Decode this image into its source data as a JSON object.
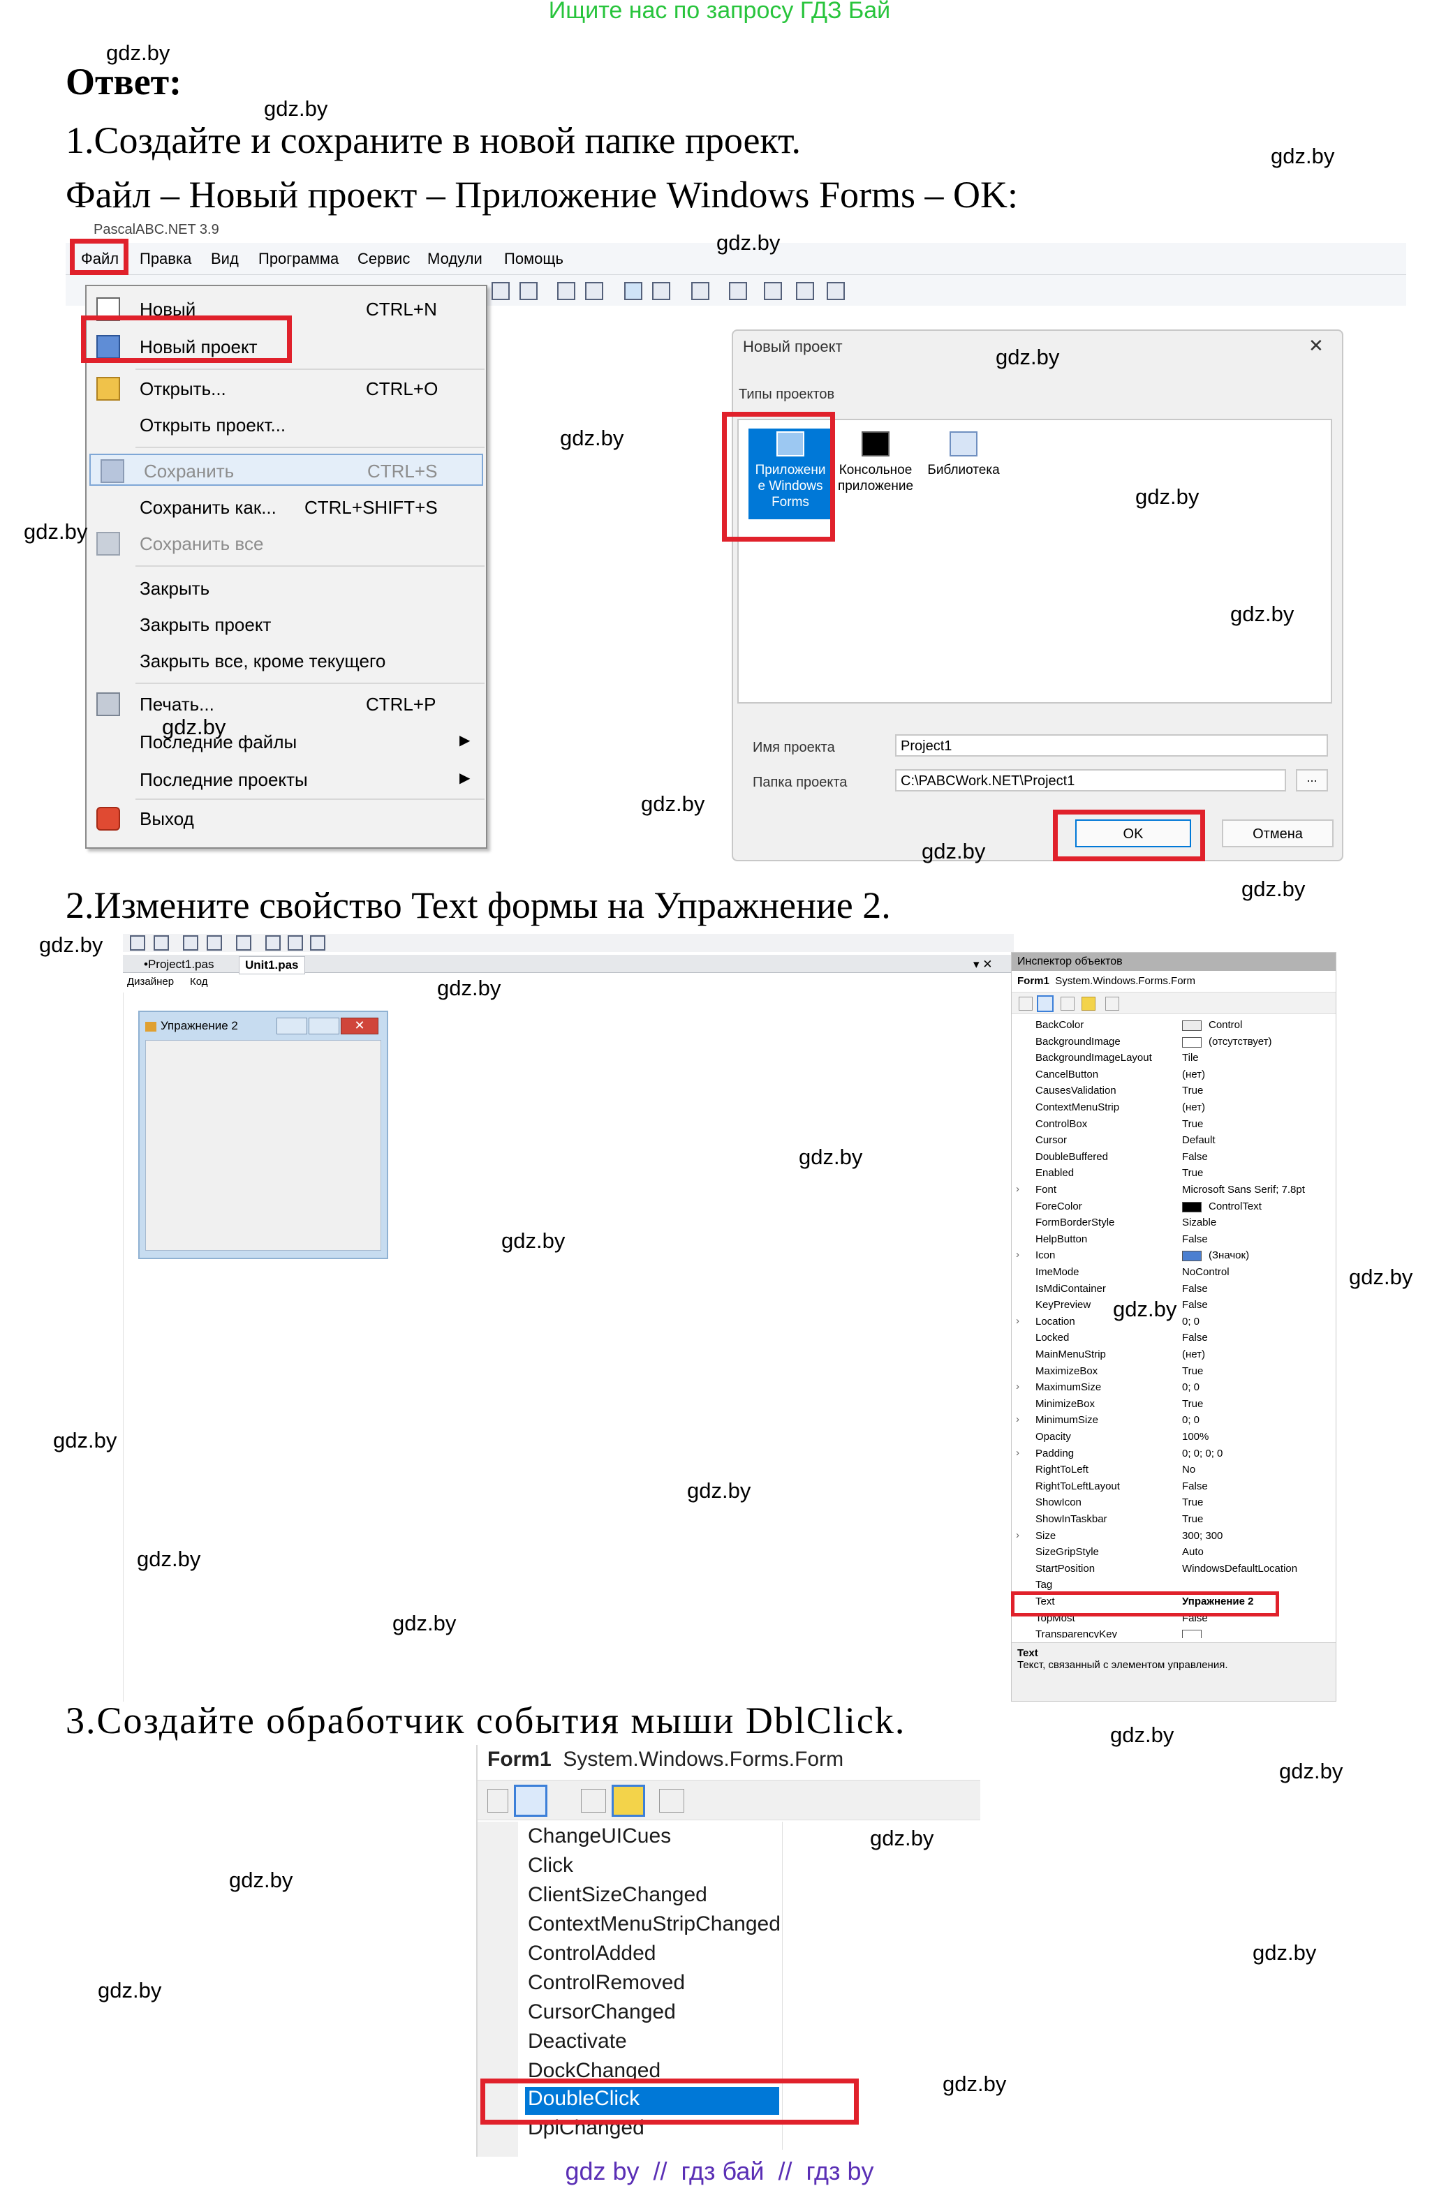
{
  "header": {
    "top_banner": "Ищите нас по запросу ГДЗ Бай",
    "answer_heading": "Ответ:"
  },
  "steps": {
    "step1": "1.Создайте и сохраните в новой папке проект.",
    "step1_path": "Файл – Новый проект – Приложение Windows Forms – OK:",
    "step2": "2.Измените свойство Text формы на Упражнение 2.",
    "step3": "3.Создайте обработчик события мыши DblClick."
  },
  "ide": {
    "title_fragment": "PascalABC.NET 3.9",
    "menu": [
      "Файл",
      "Правка",
      "Вид",
      "Программа",
      "Сервис",
      "Модули",
      "Помощь"
    ],
    "file_menu": [
      {
        "label": "Новый",
        "shortcut": "CTRL+N",
        "icon": "new-file-icon",
        "enabled": true
      },
      {
        "label": "Новый проект",
        "shortcut": "",
        "icon": "new-project-icon",
        "enabled": true
      },
      {
        "label": "Открыть...",
        "shortcut": "CTRL+O",
        "icon": "open-folder-icon",
        "enabled": true
      },
      {
        "label": "Открыть проект...",
        "shortcut": "",
        "icon": "",
        "enabled": true
      },
      {
        "label": "Сохранить",
        "shortcut": "CTRL+S",
        "icon": "save-icon",
        "enabled": false
      },
      {
        "label": "Сохранить как...",
        "shortcut": "CTRL+SHIFT+S",
        "icon": "",
        "enabled": true
      },
      {
        "label": "Сохранить все",
        "shortcut": "",
        "icon": "save-all-icon",
        "enabled": false
      },
      {
        "label": "Закрыть",
        "shortcut": "",
        "icon": "",
        "enabled": true
      },
      {
        "label": "Закрыть проект",
        "shortcut": "",
        "icon": "",
        "enabled": true
      },
      {
        "label": "Закрыть все, кроме текущего",
        "shortcut": "",
        "icon": "",
        "enabled": true
      },
      {
        "label": "Печать...",
        "shortcut": "CTRL+P",
        "icon": "printer-icon",
        "enabled": true
      },
      {
        "label": "Последние файлы",
        "shortcut": "▶",
        "icon": "",
        "enabled": true
      },
      {
        "label": "Последние проекты",
        "shortcut": "▶",
        "icon": "",
        "enabled": true
      },
      {
        "label": "Выход",
        "shortcut": "",
        "icon": "exit-icon",
        "enabled": true
      }
    ]
  },
  "new_project_dialog": {
    "title": "Новый проект",
    "close": "✕",
    "types_label": "Типы проектов",
    "types": [
      {
        "label": "Приложение Windows Forms",
        "line1": "Приложени",
        "line2": "е Windows",
        "line3": "Forms",
        "icon": "windows-forms-icon",
        "selected": true
      },
      {
        "label": "Консольное приложение",
        "line1": "Консольное",
        "line2": "приложение",
        "icon": "console-icon",
        "selected": false
      },
      {
        "label": "Библиотека",
        "line1": "Библиотека",
        "icon": "library-icon",
        "selected": false
      }
    ],
    "name_label": "Имя проекта",
    "name_value": "Project1",
    "folder_label": "Папка проекта",
    "folder_value": "C:\\PABCWork.NET\\Project1",
    "browse": "...",
    "ok": "OK",
    "cancel": "Отмена"
  },
  "designer": {
    "tabs": [
      "•Project1.pas",
      "Unit1.pas"
    ],
    "subtabs": [
      "Дизайнер",
      "Код"
    ],
    "tab_controls": "▾ ✕",
    "form_caption": "Упражнение 2"
  },
  "inspector": {
    "title": "Инспектор объектов",
    "object": "Form1",
    "object_type": "System.Windows.Forms.Form",
    "properties": [
      {
        "name": "BackColor",
        "value": "Control",
        "swatch": "#ececec",
        "expand": false
      },
      {
        "name": "BackgroundImage",
        "value": "(отсутствует)",
        "swatch": "#ffffff",
        "expand": false
      },
      {
        "name": "BackgroundImageLayout",
        "value": "Tile",
        "expand": false
      },
      {
        "name": "CancelButton",
        "value": "(нет)",
        "expand": false
      },
      {
        "name": "CausesValidation",
        "value": "True",
        "expand": false
      },
      {
        "name": "ContextMenuStrip",
        "value": "(нет)",
        "expand": false
      },
      {
        "name": "ControlBox",
        "value": "True",
        "expand": false
      },
      {
        "name": "Cursor",
        "value": "Default",
        "expand": false
      },
      {
        "name": "DoubleBuffered",
        "value": "False",
        "expand": false
      },
      {
        "name": "Enabled",
        "value": "True",
        "expand": false
      },
      {
        "name": "Font",
        "value": "Microsoft Sans Serif; 7.8pt",
        "expand": true
      },
      {
        "name": "ForeColor",
        "value": "ControlText",
        "swatch": "#000000",
        "expand": false
      },
      {
        "name": "FormBorderStyle",
        "value": "Sizable",
        "expand": false
      },
      {
        "name": "HelpButton",
        "value": "False",
        "expand": false
      },
      {
        "name": "Icon",
        "value": "(Значок)",
        "swatch": "#4b7fd0",
        "expand": true
      },
      {
        "name": "ImeMode",
        "value": "NoControl",
        "expand": false
      },
      {
        "name": "IsMdiContainer",
        "value": "False",
        "expand": false
      },
      {
        "name": "KeyPreview",
        "value": "False",
        "expand": false
      },
      {
        "name": "Location",
        "value": "0; 0",
        "expand": true
      },
      {
        "name": "Locked",
        "value": "False",
        "expand": false
      },
      {
        "name": "MainMenuStrip",
        "value": "(нет)",
        "expand": false
      },
      {
        "name": "MaximizeBox",
        "value": "True",
        "expand": false
      },
      {
        "name": "MaximumSize",
        "value": "0; 0",
        "expand": true
      },
      {
        "name": "MinimizeBox",
        "value": "True",
        "expand": false
      },
      {
        "name": "MinimumSize",
        "value": "0; 0",
        "expand": true
      },
      {
        "name": "Opacity",
        "value": "100%",
        "expand": false
      },
      {
        "name": "Padding",
        "value": "0; 0; 0; 0",
        "expand": true
      },
      {
        "name": "RightToLeft",
        "value": "No",
        "expand": false
      },
      {
        "name": "RightToLeftLayout",
        "value": "False",
        "expand": false
      },
      {
        "name": "ShowIcon",
        "value": "True",
        "expand": false
      },
      {
        "name": "ShowInTaskbar",
        "value": "True",
        "expand": false
      },
      {
        "name": "Size",
        "value": "300; 300",
        "expand": true
      },
      {
        "name": "SizeGripStyle",
        "value": "Auto",
        "expand": false
      },
      {
        "name": "StartPosition",
        "value": "WindowsDefaultLocation",
        "expand": false
      },
      {
        "name": "Tag",
        "value": "",
        "expand": false
      },
      {
        "name": "Text",
        "value": "Упражнение 2",
        "expand": false
      },
      {
        "name": "TopMost",
        "value": "False",
        "expand": false
      },
      {
        "name": "TransparencyKey",
        "value": "",
        "swatch": "#ffffff",
        "expand": false
      }
    ],
    "help_title": "Text",
    "help_text": "Текст, связанный с элементом управления."
  },
  "events": {
    "object": "Form1",
    "object_type": "System.Windows.Forms.Form",
    "items": [
      "ChangeUICues",
      "Click",
      "ClientSizeChanged",
      "ContextMenuStripChanged",
      "ControlAdded",
      "ControlRemoved",
      "CursorChanged",
      "Deactivate",
      "DockChanged",
      "DoubleClick",
      "DpiChanged"
    ],
    "selected": "DoubleClick"
  },
  "footer": {
    "links": "gdz by  //  гдз бай  //  гдз by"
  },
  "watermark": "gdz.by",
  "colors": {
    "highlight": "#e0212b",
    "banner": "#28c43c",
    "footer": "#5a2fb5",
    "selection": "#0078d7"
  }
}
